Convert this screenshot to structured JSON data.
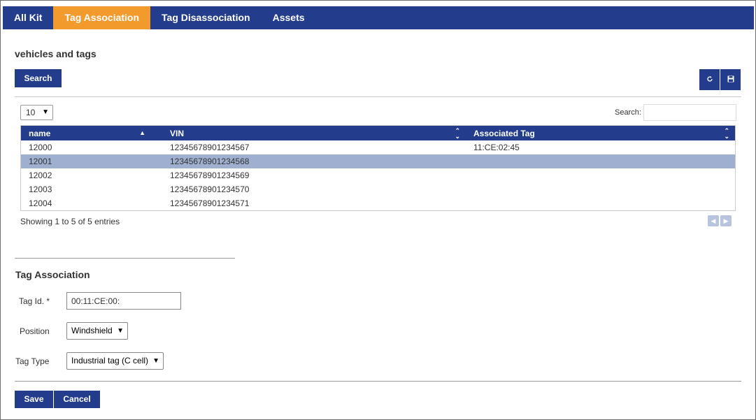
{
  "nav": {
    "tabs": [
      {
        "label": "All Kit"
      },
      {
        "label": "Tag Association"
      },
      {
        "label": "Tag Disassociation"
      },
      {
        "label": "Assets"
      }
    ],
    "active_index": 1,
    "active_color": "#f39a2c",
    "bar_color": "#243c8c"
  },
  "vehicles": {
    "title": "vehicles and tags",
    "search_button": "Search",
    "refresh_icon": "refresh-icon",
    "save_icon": "floppy-disk-icon",
    "page_length": "10",
    "search_label": "Search:",
    "search_value": "",
    "columns": [
      "name",
      "VIN",
      "Associated Tag"
    ],
    "rows": [
      {
        "name": "12000",
        "vin": "12345678901234567",
        "tag": "11:CE:02:45"
      },
      {
        "name": "12001",
        "vin": "12345678901234568",
        "tag": ""
      },
      {
        "name": "12002",
        "vin": "12345678901234569",
        "tag": ""
      },
      {
        "name": "12003",
        "vin": "12345678901234570",
        "tag": ""
      },
      {
        "name": "12004",
        "vin": "12345678901234571",
        "tag": ""
      }
    ],
    "selected_row": 1,
    "info": "Showing 1 to 5 of 5 entries"
  },
  "form": {
    "title": "Tag Association",
    "tag_id_label": "Tag Id. *",
    "tag_id_value": "00:11:CE:00:",
    "position_label": "Position",
    "position_value": "Windshield",
    "tag_type_label": "Tag Type",
    "tag_type_value": "Industrial tag (C cell)",
    "save_label": "Save",
    "cancel_label": "Cancel"
  }
}
